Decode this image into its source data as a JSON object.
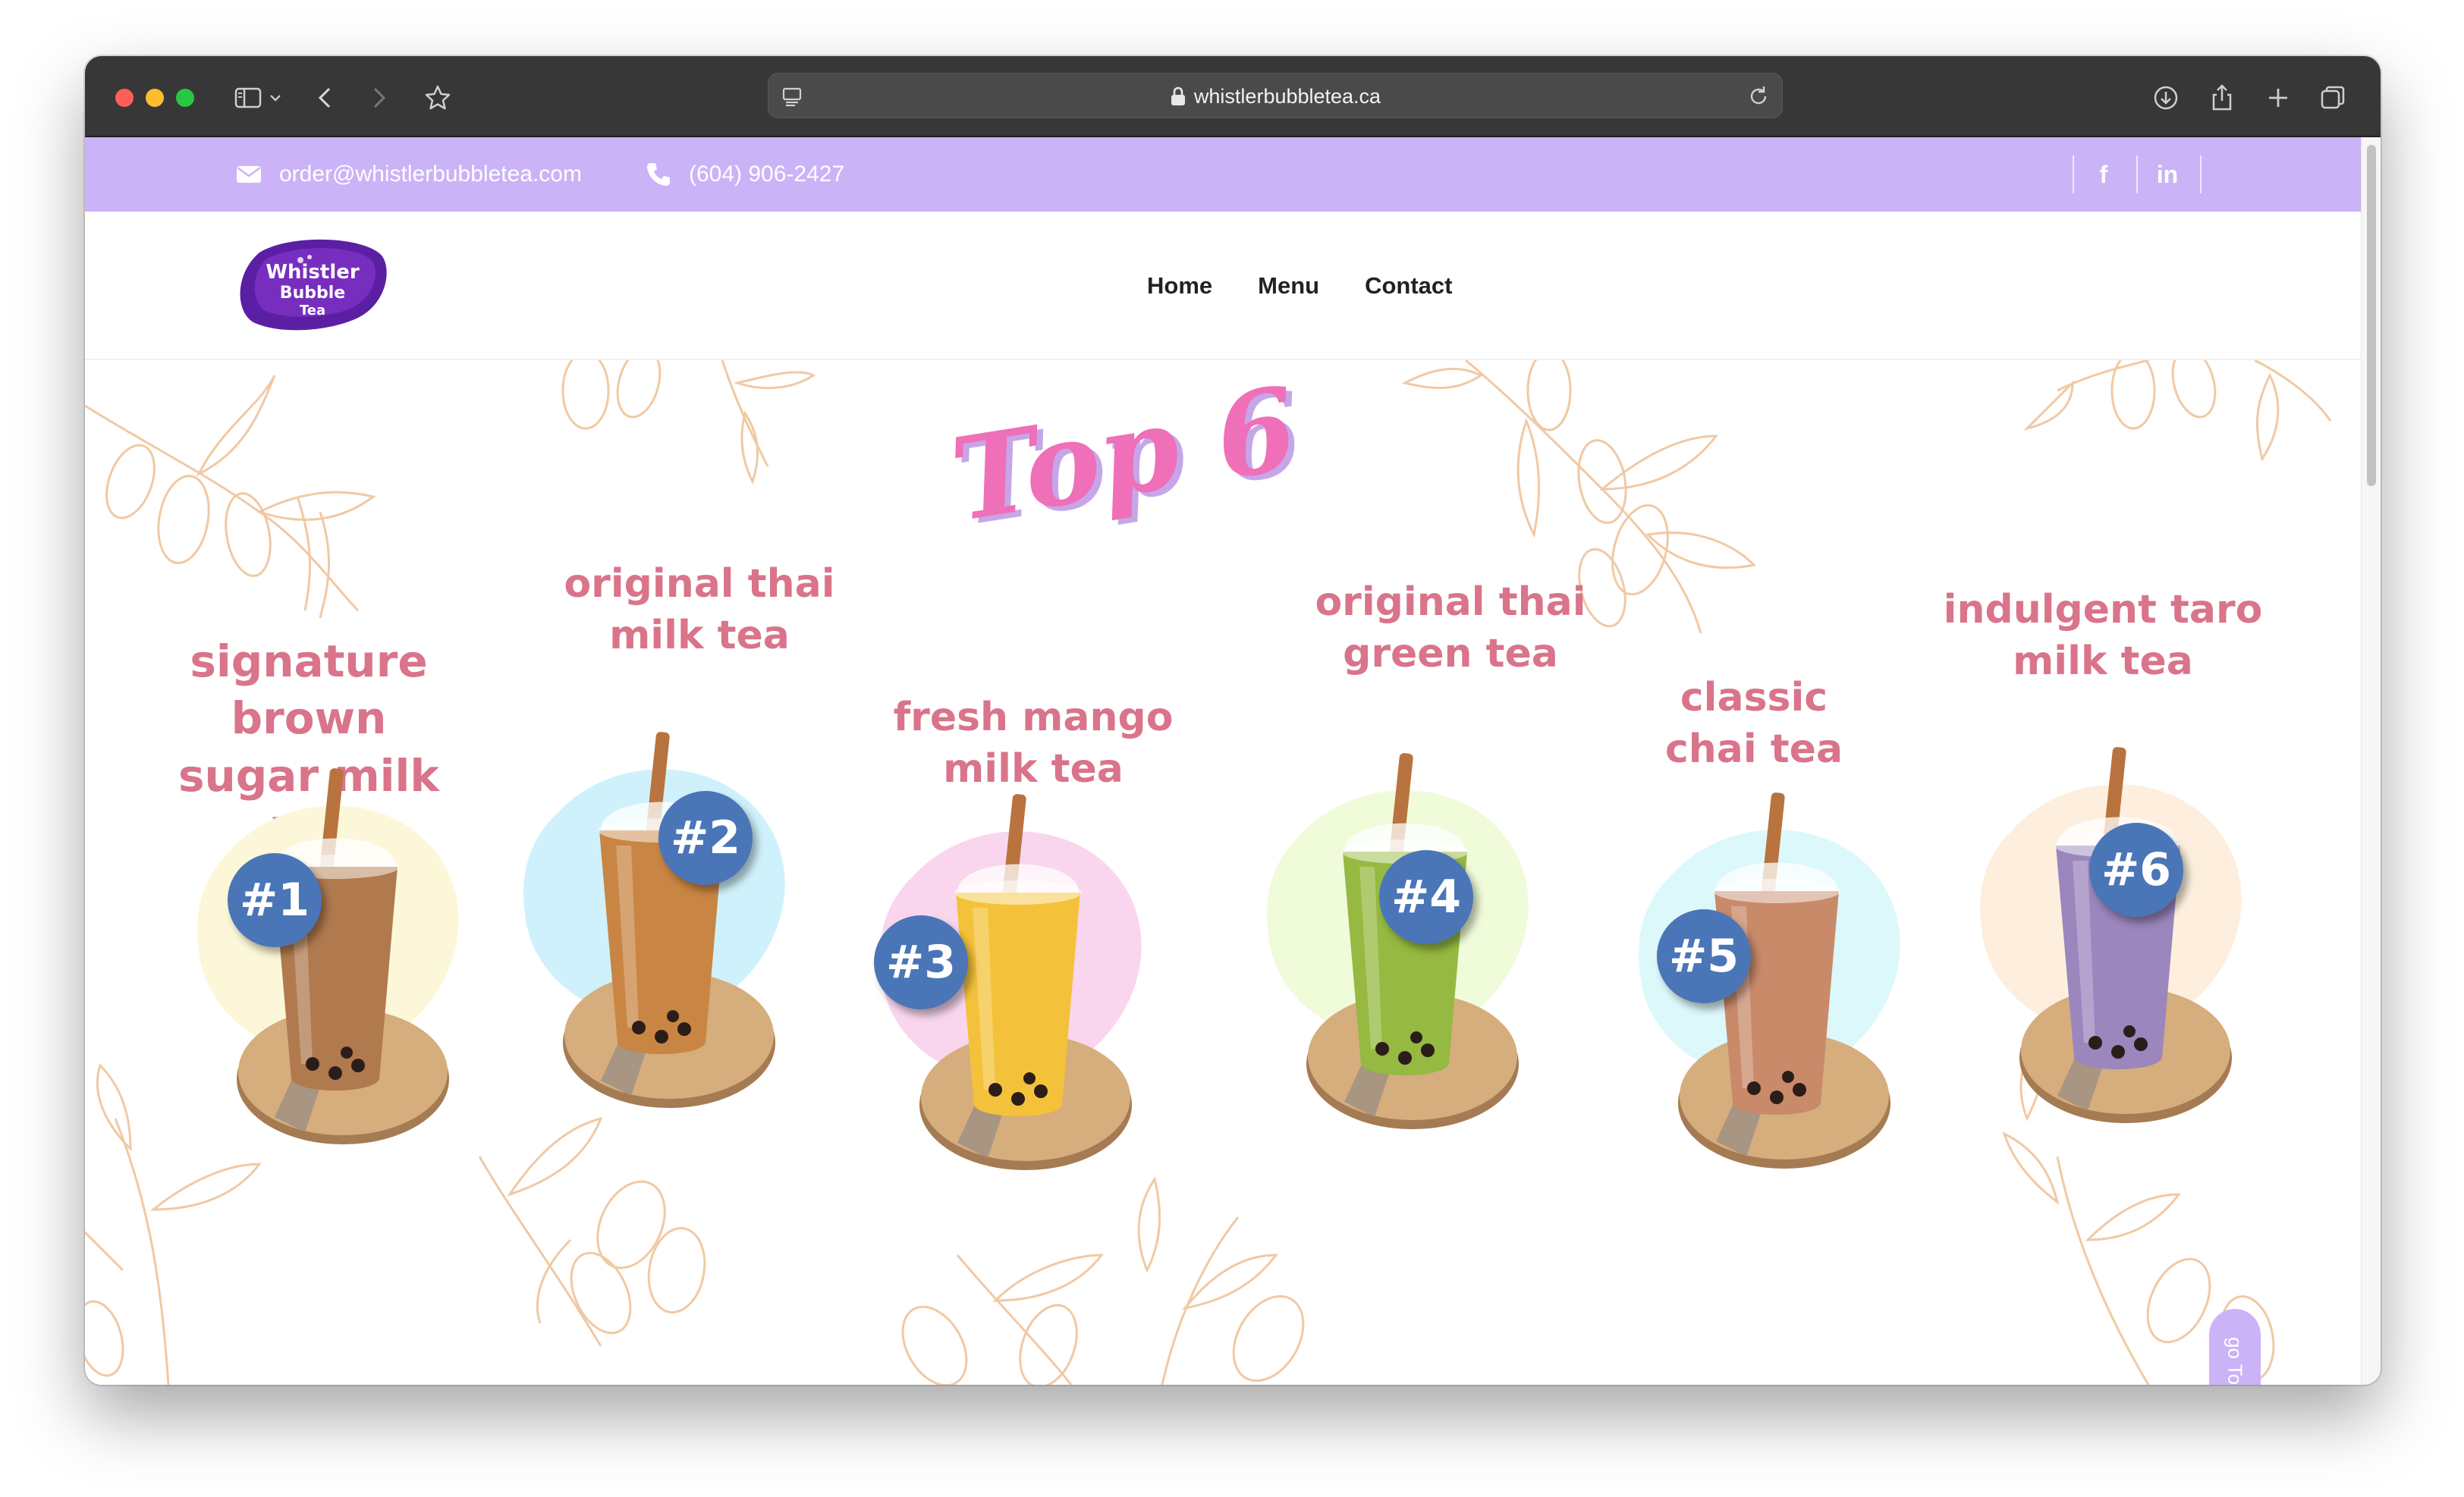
{
  "browser": {
    "url": "whistlerbubbletea.ca",
    "icons": [
      "sidebar-icon",
      "chevron-down-icon",
      "back-icon",
      "forward-icon",
      "bookmark-star-icon",
      "reader-icon",
      "lock-icon",
      "reload-icon",
      "download-icon",
      "share-icon",
      "new-tab-icon",
      "tabs-overview-icon"
    ]
  },
  "topbar": {
    "email": "order@whistlerbubbletea.com",
    "phone": "(604) 906-2427",
    "social": {
      "facebook": "f",
      "linkedin": "in"
    }
  },
  "nav": {
    "logo_text": [
      "Whistler",
      "Bubble",
      "Tea"
    ],
    "links": [
      {
        "label": "Home"
      },
      {
        "label": "Menu"
      },
      {
        "label": "Contact"
      }
    ]
  },
  "hero": {
    "heading": "Top 6",
    "drinks": [
      {
        "rank": "#1",
        "title_line1": "signature brown",
        "title_line2": "sugar milk tea",
        "blob_color": "#fdf7d9",
        "tea_color": "#b07a4e"
      },
      {
        "rank": "#2",
        "title_line1": "original thai",
        "title_line2": "milk tea",
        "blob_color": "#cff1fb",
        "tea_color": "#c98543"
      },
      {
        "rank": "#3",
        "title_line1": "fresh mango",
        "title_line2": "milk tea",
        "blob_color": "#f9d6ee",
        "tea_color": "#f4c23a"
      },
      {
        "rank": "#4",
        "title_line1": "original thai",
        "title_line2": "green tea",
        "blob_color": "#effbd9",
        "tea_color": "#96b941"
      },
      {
        "rank": "#5",
        "title_line1": "classic",
        "title_line2": "chai tea",
        "blob_color": "#dcf8fb",
        "tea_color": "#c98a6a"
      },
      {
        "rank": "#6",
        "title_line1": "indulgent taro",
        "title_line2": "milk tea",
        "blob_color": "#fdeedd",
        "tea_color": "#9b86bd"
      }
    ]
  },
  "go_top": {
    "label": "go To Top"
  },
  "colors": {
    "topbar": "#cbb3f7",
    "title_pink": "#d9748a",
    "badge_blue": "#4a76b8",
    "top6_pink": "#ef6fb9",
    "leaf_stroke": "#f0c9a4"
  }
}
